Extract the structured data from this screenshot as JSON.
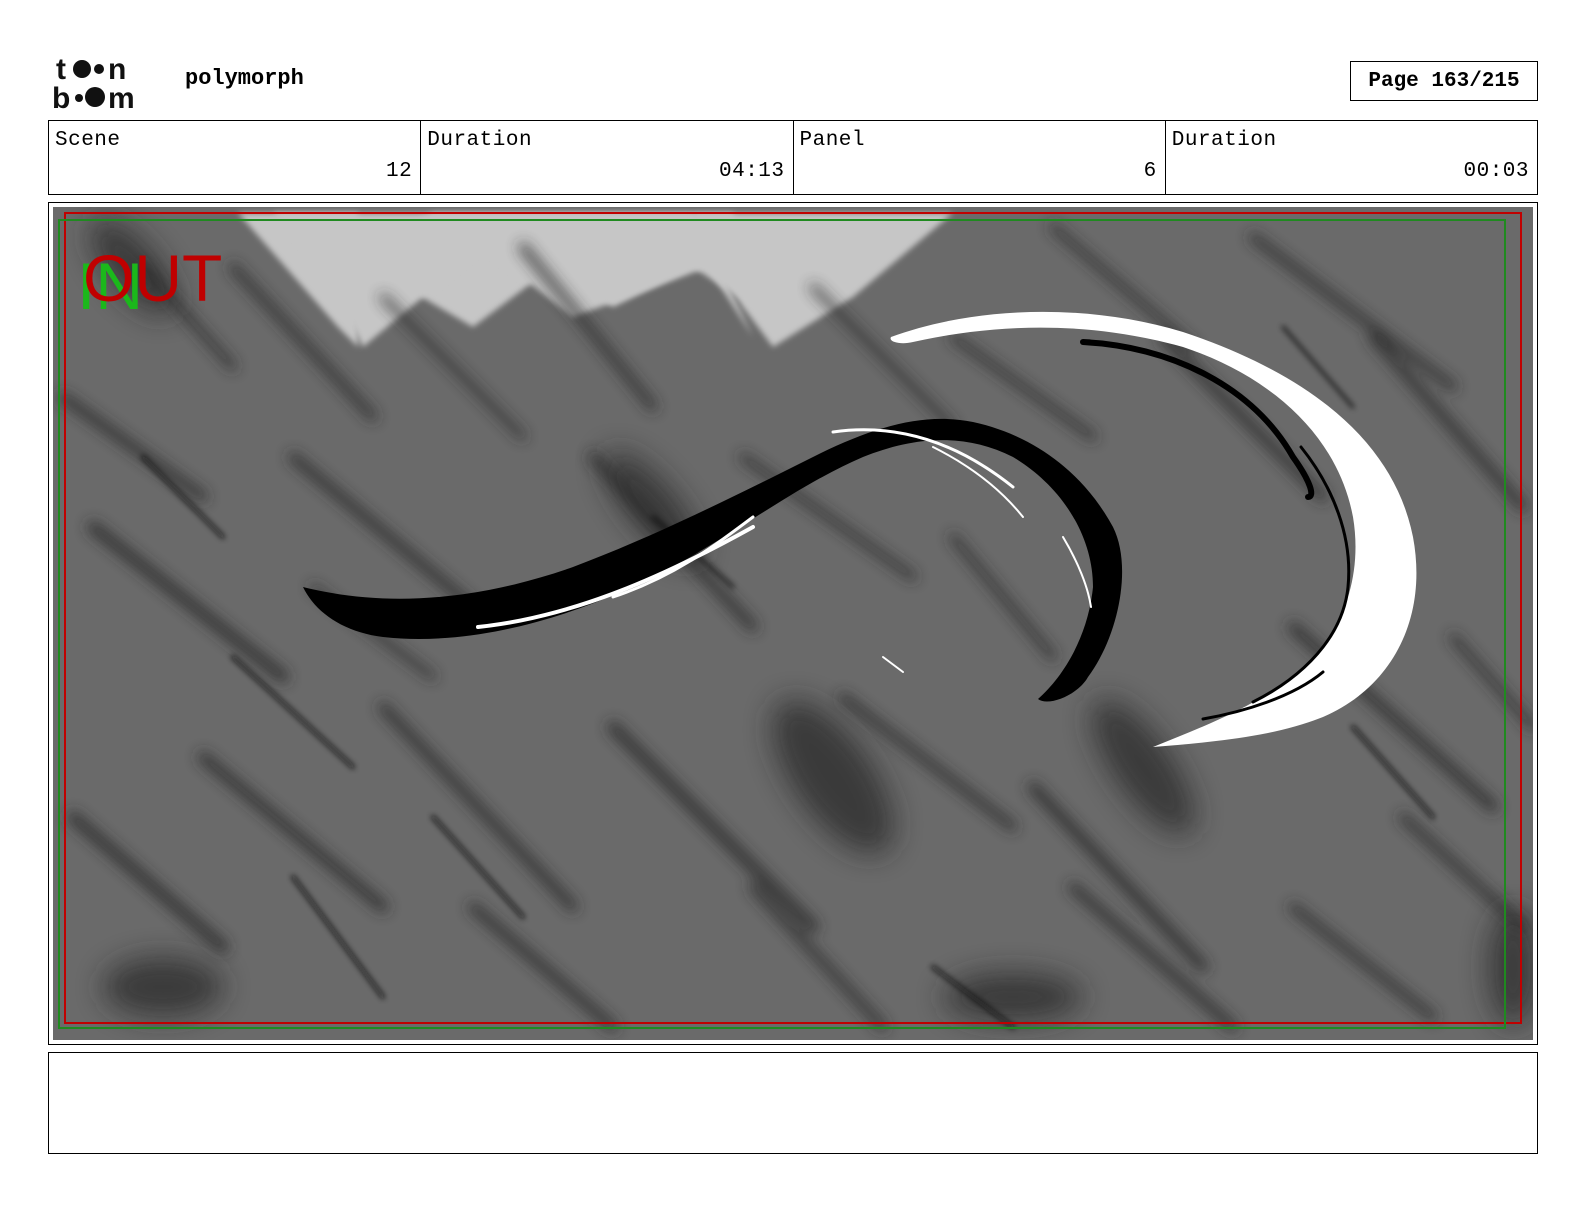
{
  "header": {
    "logo_text_top": "toon",
    "logo_text_bottom": "boom",
    "project": "polymorph",
    "page": "Page 163/215"
  },
  "info": {
    "scene_label": "Scene",
    "scene_value": "12",
    "scene_duration_label": "Duration",
    "scene_duration_value": "04:13",
    "panel_label": "Panel",
    "panel_value": "6",
    "panel_duration_label": "Duration",
    "panel_duration_value": "00:03"
  },
  "panel": {
    "in_mark": "IN",
    "out_mark": "OUT",
    "colors": {
      "background": "#6a6a6a",
      "sky": "#c6c6c6",
      "title_safe": "#c00000",
      "action_safe": "#1f8a1f",
      "in_mark": "#1bb81b",
      "out_mark": "#c00000"
    }
  },
  "notes": {
    "text": ""
  }
}
